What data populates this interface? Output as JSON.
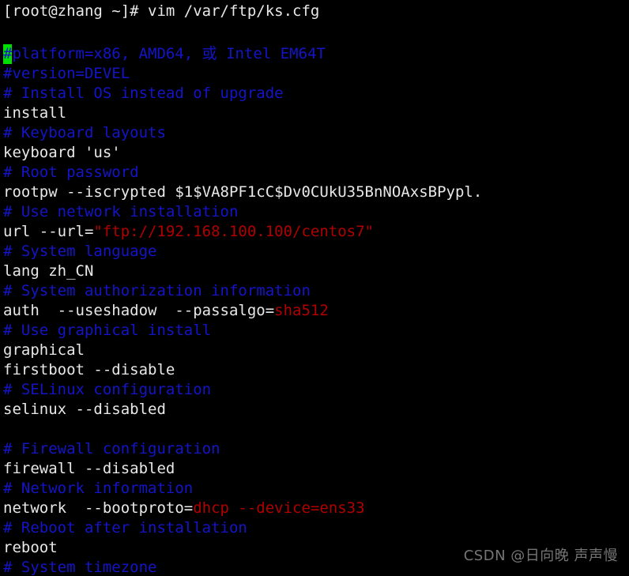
{
  "terminal": {
    "background_color": "#000000",
    "foreground_color": "#e8e8e8",
    "comment_color": "#1414c8",
    "string_color": "#b00000",
    "cursor_color": "#00e000",
    "prompt_line": "[root@zhang ~]# vim /var/ftp/ks.cfg",
    "cursor": {
      "char": "#",
      "line_index": 0,
      "column_index": 0
    }
  },
  "editor": {
    "file_path": "/var/ftp/ks.cfg",
    "command": "vim",
    "lines": [
      {
        "id": "line-1",
        "segments": [
          {
            "text": "#",
            "style": "cursor"
          },
          {
            "text": "platform=x86, AMD64, 或 Intel EM64T",
            "style": "comment"
          }
        ]
      },
      {
        "id": "line-2",
        "segments": [
          {
            "text": "#version=DEVEL",
            "style": "comment"
          }
        ]
      },
      {
        "id": "line-3",
        "segments": [
          {
            "text": "# Install OS instead of upgrade",
            "style": "comment"
          }
        ]
      },
      {
        "id": "line-4",
        "segments": [
          {
            "text": "install",
            "style": "normal"
          }
        ]
      },
      {
        "id": "line-5",
        "segments": [
          {
            "text": "# Keyboard layouts",
            "style": "comment"
          }
        ]
      },
      {
        "id": "line-6",
        "segments": [
          {
            "text": "keyboard 'us'",
            "style": "normal"
          }
        ]
      },
      {
        "id": "line-7",
        "segments": [
          {
            "text": "# Root password",
            "style": "comment"
          }
        ]
      },
      {
        "id": "line-8",
        "segments": [
          {
            "text": "rootpw --iscrypted $1$VA8PF1cC$Dv0CUkU35BnNOAxsBPypl.",
            "style": "normal"
          }
        ]
      },
      {
        "id": "line-9",
        "segments": [
          {
            "text": "# Use network installation",
            "style": "comment"
          }
        ]
      },
      {
        "id": "line-10",
        "segments": [
          {
            "text": "url --url=",
            "style": "normal"
          },
          {
            "text": "\"ftp://192.168.100.100/centos7\"",
            "style": "string"
          }
        ]
      },
      {
        "id": "line-11",
        "segments": [
          {
            "text": "# System language",
            "style": "comment"
          }
        ]
      },
      {
        "id": "line-12",
        "segments": [
          {
            "text": "lang zh_CN",
            "style": "normal"
          }
        ]
      },
      {
        "id": "line-13",
        "segments": [
          {
            "text": "# System authorization information",
            "style": "comment"
          }
        ]
      },
      {
        "id": "line-14",
        "segments": [
          {
            "text": "auth  --useshadow  --passalgo=",
            "style": "normal"
          },
          {
            "text": "sha512",
            "style": "string"
          }
        ]
      },
      {
        "id": "line-15",
        "segments": [
          {
            "text": "# Use graphical install",
            "style": "comment"
          }
        ]
      },
      {
        "id": "line-16",
        "segments": [
          {
            "text": "graphical",
            "style": "normal"
          }
        ]
      },
      {
        "id": "line-17",
        "segments": [
          {
            "text": "firstboot --disable",
            "style": "normal"
          }
        ]
      },
      {
        "id": "line-18",
        "segments": [
          {
            "text": "# SELinux configuration",
            "style": "comment"
          }
        ]
      },
      {
        "id": "line-19",
        "segments": [
          {
            "text": "selinux --disabled",
            "style": "normal"
          }
        ]
      },
      {
        "id": "line-20",
        "segments": [
          {
            "text": "",
            "style": "normal"
          }
        ]
      },
      {
        "id": "line-21",
        "segments": [
          {
            "text": "# Firewall configuration",
            "style": "comment"
          }
        ]
      },
      {
        "id": "line-22",
        "segments": [
          {
            "text": "firewall --disabled",
            "style": "normal"
          }
        ]
      },
      {
        "id": "line-23",
        "segments": [
          {
            "text": "# Network information",
            "style": "comment"
          }
        ]
      },
      {
        "id": "line-24",
        "segments": [
          {
            "text": "network  --bootproto=",
            "style": "normal"
          },
          {
            "text": "dhcp --device=ens33",
            "style": "string"
          }
        ]
      },
      {
        "id": "line-25",
        "segments": [
          {
            "text": "# Reboot after installation",
            "style": "comment"
          }
        ]
      },
      {
        "id": "line-26",
        "segments": [
          {
            "text": "reboot",
            "style": "normal"
          }
        ]
      },
      {
        "id": "line-27",
        "segments": [
          {
            "text": "# System timezone",
            "style": "comment"
          }
        ]
      }
    ]
  },
  "watermark": {
    "text": "CSDN @日向晚 声声慢"
  }
}
